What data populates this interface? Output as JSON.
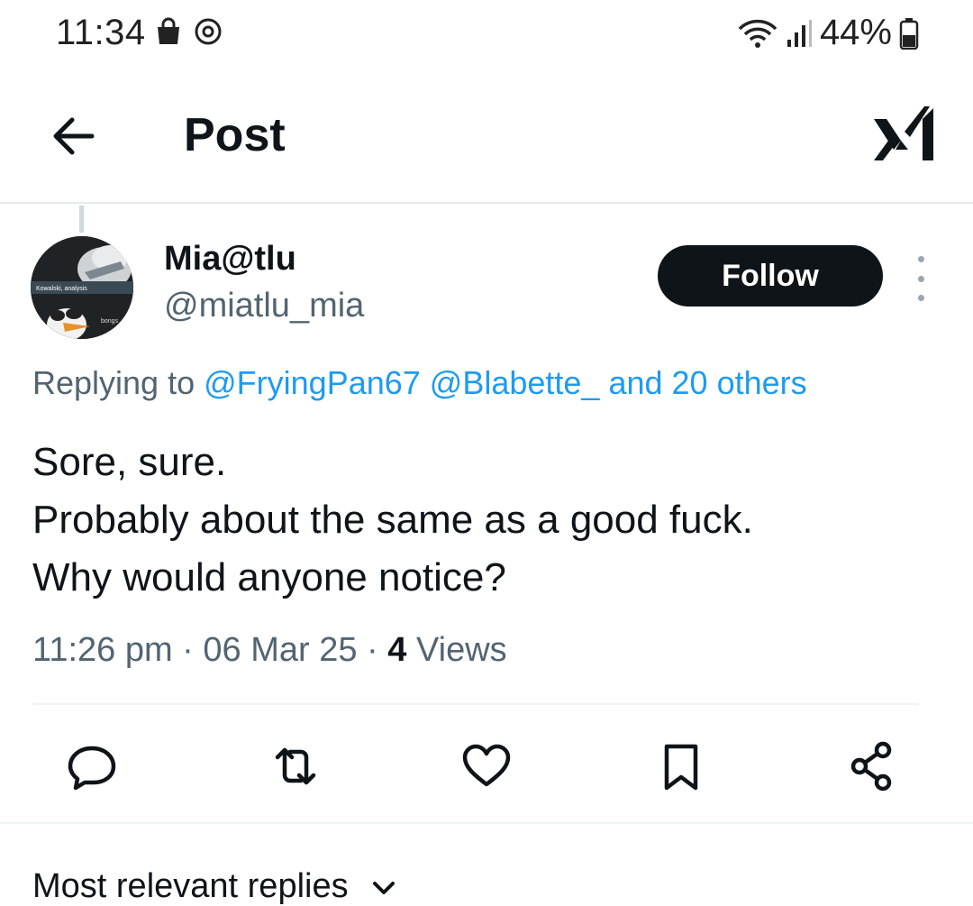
{
  "status_bar": {
    "time": "11:34",
    "battery": "44%",
    "icons": [
      "shopping-bag-icon",
      "sync-icon",
      "wifi-icon",
      "signal-icon",
      "battery-icon"
    ]
  },
  "header": {
    "title": "Post",
    "back_icon": "arrow-left-icon",
    "logo_icon": "x-grok-icon"
  },
  "post": {
    "author_name": "Mia@tlu",
    "author_handle": "@miatlu_mia",
    "follow_label": "Follow",
    "replying_prefix": "Replying to",
    "replying_mentions": "@FryingPan67 @Blabette_ and 20 others",
    "lines": [
      "Sore, sure.",
      "Probably about the same as a good fuck.",
      "Why would anyone notice?"
    ],
    "time": "11:26 pm",
    "date": "06 Mar 25",
    "views_count": "4",
    "views_label": "Views",
    "avatar_texts": [
      "Kowalski, analysis",
      "bongs"
    ]
  },
  "actions": [
    "reply-icon",
    "repost-icon",
    "like-icon",
    "bookmark-icon",
    "share-icon"
  ],
  "replies_header": "Most relevant replies",
  "colors": {
    "link": "#1d9bf0",
    "secondary": "#536471",
    "primary": "#0f1419"
  }
}
